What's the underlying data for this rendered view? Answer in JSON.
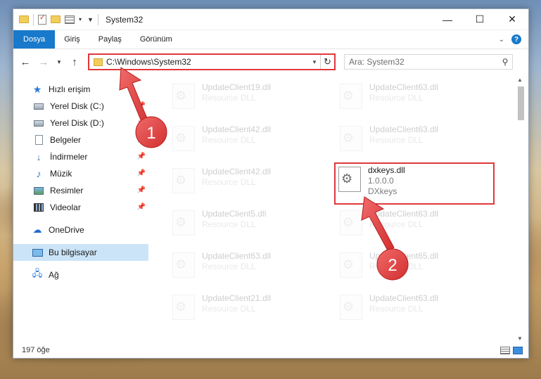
{
  "window": {
    "title": "System32",
    "controls": {
      "minimize": "—",
      "maximize": "☐",
      "close": "✕"
    }
  },
  "ribbon": {
    "tabs": [
      "Dosya",
      "Giriş",
      "Paylaş",
      "Görünüm"
    ],
    "collapse_icon": "chevron-down-icon",
    "help_label": "?"
  },
  "navigation": {
    "back": "←",
    "forward": "→",
    "recent": "▾",
    "up": "↑"
  },
  "address_bar": {
    "path": "C:\\Windows\\System32",
    "refresh": "↻",
    "dropdown": "▾"
  },
  "search": {
    "placeholder": "Ara: System32",
    "icon": "search-icon"
  },
  "sidebar": {
    "items": [
      {
        "label": "Hızlı erişim",
        "icon": "star-icon",
        "level": "top",
        "pinned": false
      },
      {
        "label": "Yerel Disk (C:)",
        "icon": "drive-icon",
        "level": "sub",
        "pinned": true
      },
      {
        "label": "Yerel Disk (D:)",
        "icon": "drive-icon",
        "level": "sub",
        "pinned": true
      },
      {
        "label": "Belgeler",
        "icon": "documents-icon",
        "level": "sub",
        "pinned": true
      },
      {
        "label": "İndirmeler",
        "icon": "download-icon",
        "level": "sub",
        "pinned": true
      },
      {
        "label": "Müzik",
        "icon": "music-icon",
        "level": "sub",
        "pinned": true
      },
      {
        "label": "Resimler",
        "icon": "pictures-icon",
        "level": "sub",
        "pinned": true
      },
      {
        "label": "Videolar",
        "icon": "videos-icon",
        "level": "sub",
        "pinned": true
      },
      {
        "label": "OneDrive",
        "icon": "cloud-icon",
        "level": "top",
        "pinned": false
      },
      {
        "label": "Bu bilgisayar",
        "icon": "computer-icon",
        "level": "top",
        "pinned": false,
        "selected": true
      },
      {
        "label": "Ağ",
        "icon": "network-icon",
        "level": "top",
        "pinned": false
      }
    ]
  },
  "files": [
    {
      "name": "UpdateClient19.dll",
      "type": "Resource DLL"
    },
    {
      "name": "UpdateClient63.dll",
      "type": "Resource DLL"
    },
    {
      "name": "UpdateClient42.dll",
      "type": "Resource DLL"
    },
    {
      "name": "UpdateClient63.dll",
      "type": "Resource DLL"
    },
    {
      "name": "UpdateClient42.dll",
      "type": "Resource DLL"
    },
    {
      "name": "dxkeys.dll",
      "version": "1.0.0.0",
      "type": "DXkeys",
      "highlighted": true
    },
    {
      "name": "UpdateClient5.dll",
      "type": "Resource DLL"
    },
    {
      "name": "UpdateClient63.dll",
      "type": "Resource DLL"
    },
    {
      "name": "UpdateClient63.dll",
      "type": "Resource DLL"
    },
    {
      "name": "UpdateClient65.dll",
      "type": "Resource DLL"
    },
    {
      "name": "UpdateClient21.dll",
      "type": "Resource DLL"
    },
    {
      "name": "UpdateClient63.dll",
      "type": "Resource DLL"
    }
  ],
  "status": {
    "item_count": "197 öğe"
  },
  "annotations": [
    {
      "number": "1",
      "target": "address bar"
    },
    {
      "number": "2",
      "target": "dxkeys.dll"
    }
  ],
  "colors": {
    "accent": "#1979ca",
    "highlight": "#e0383c",
    "selection": "#cce4f7"
  }
}
